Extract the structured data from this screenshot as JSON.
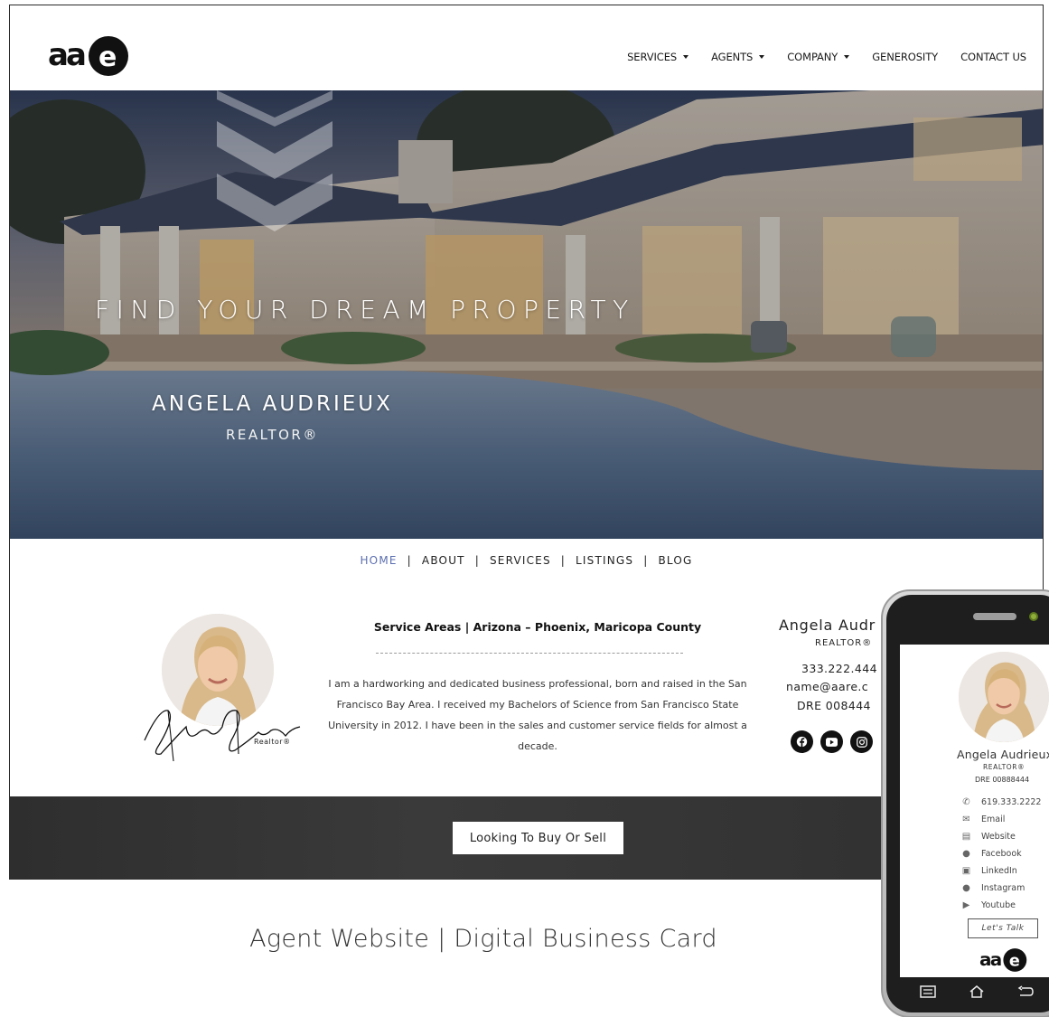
{
  "header": {
    "logo_text": "aare",
    "nav": [
      {
        "label": "SERVICES",
        "dropdown": true
      },
      {
        "label": "AGENTS",
        "dropdown": true
      },
      {
        "label": "COMPANY",
        "dropdown": true
      },
      {
        "label": "GENEROSITY",
        "dropdown": false
      },
      {
        "label": "CONTACT US",
        "dropdown": false
      }
    ]
  },
  "hero": {
    "title": "FIND YOUR DREAM PROPERTY",
    "agent_name": "ANGELA AUDRIEUX",
    "agent_title": "REALTOR®"
  },
  "subnav": {
    "items": [
      "HOME",
      "ABOUT",
      "SERVICES",
      "LISTINGS",
      "BLOG"
    ],
    "active": "HOME",
    "accent_color": "#5b6fb0"
  },
  "profile": {
    "signature_caption": "Realtor®",
    "service_areas": "Service Areas | Arizona – Phoenix, Maricopa County",
    "bio": "I am a hardworking and dedicated business professional, born and raised in the San Francisco Bay Area. I received my Bachelors of Science from San Francisco State University in 2012. I have been in the sales and customer service fields for almost a decade."
  },
  "contact": {
    "name": "Angela Audr",
    "title": "REALTOR®",
    "phone": "333.222.444",
    "email": "name@aare.c",
    "dre": "DRE  008444",
    "social_icons": [
      "facebook-icon",
      "youtube-icon",
      "instagram-icon"
    ]
  },
  "band": {
    "button_label": "Looking To Buy Or Sell"
  },
  "caption": "Agent Website | Digital Business Card",
  "phone": {
    "name": "Angela Audrieux",
    "title": "REALTOR®",
    "dre": "DRE 00888444",
    "links": [
      {
        "icon": "phone-icon",
        "label": "619.333.2222"
      },
      {
        "icon": "email-icon",
        "label": "Email"
      },
      {
        "icon": "website-icon",
        "label": "Website"
      },
      {
        "icon": "facebook-icon",
        "label": "Facebook"
      },
      {
        "icon": "linkedin-icon",
        "label": "LinkedIn"
      },
      {
        "icon": "instagram-icon",
        "label": "Instagram"
      },
      {
        "icon": "youtube-icon",
        "label": "Youtube"
      }
    ],
    "cta_label": "Let's Talk",
    "logo_text": "aare"
  }
}
